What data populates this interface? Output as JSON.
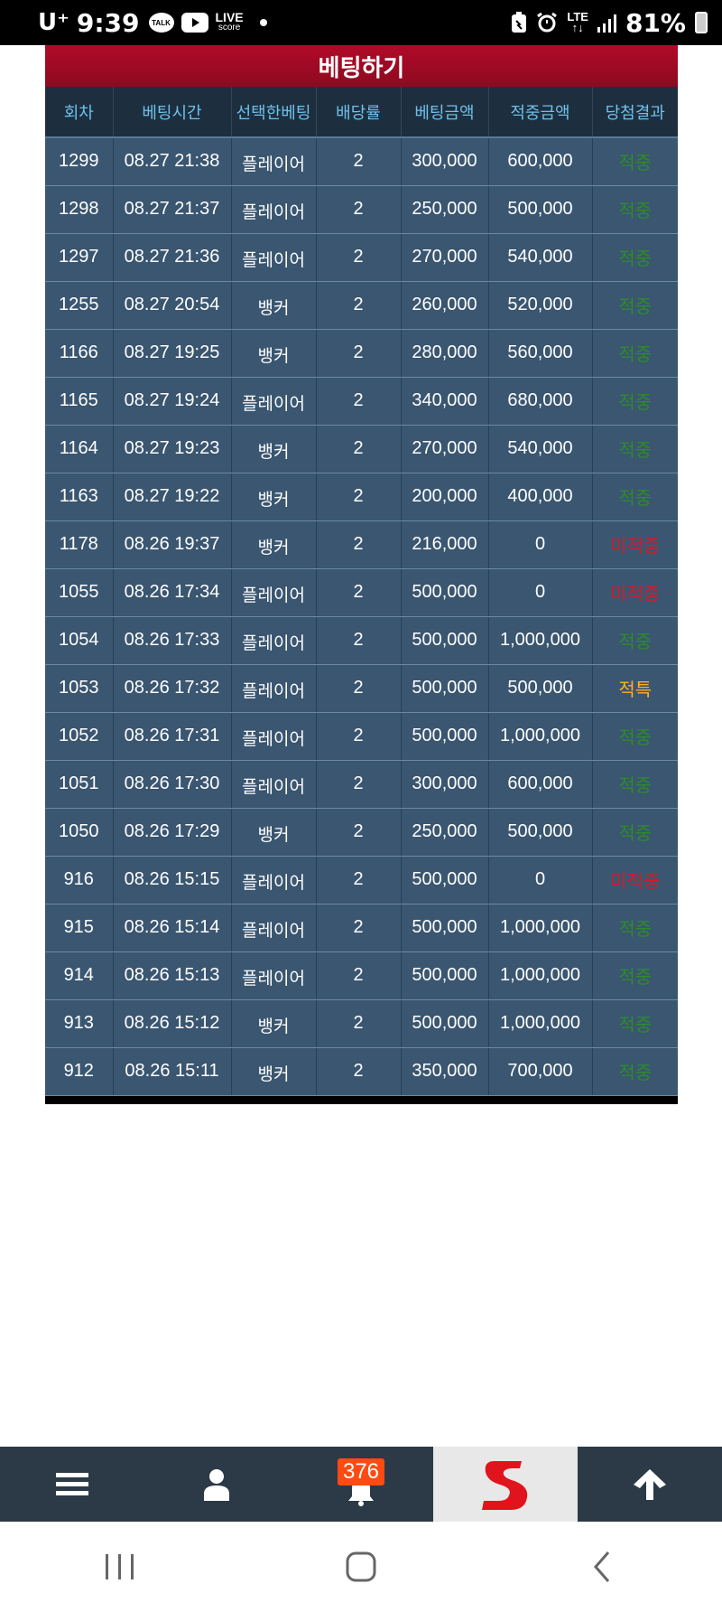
{
  "status_bar": {
    "carrier": "U⁺",
    "time": "9:39",
    "talk_label": "TALK",
    "live_label": "LIVE",
    "score_label": "score",
    "network": "LTE",
    "battery": "81%"
  },
  "panel": {
    "title": "베팅하기",
    "columns": [
      "회차",
      "베팅시간",
      "선택한베팅",
      "배당률",
      "베팅금액",
      "적중금액",
      "당첨결과"
    ],
    "rows": [
      {
        "round": "1299",
        "time": "08.27 21:38",
        "choice": "플레이어",
        "odds": "2",
        "bet": "300,000",
        "win": "600,000",
        "result": "적중",
        "result_type": "win"
      },
      {
        "round": "1298",
        "time": "08.27 21:37",
        "choice": "플레이어",
        "odds": "2",
        "bet": "250,000",
        "win": "500,000",
        "result": "적중",
        "result_type": "win"
      },
      {
        "round": "1297",
        "time": "08.27 21:36",
        "choice": "플레이어",
        "odds": "2",
        "bet": "270,000",
        "win": "540,000",
        "result": "적중",
        "result_type": "win"
      },
      {
        "round": "1255",
        "time": "08.27 20:54",
        "choice": "뱅커",
        "odds": "2",
        "bet": "260,000",
        "win": "520,000",
        "result": "적중",
        "result_type": "win"
      },
      {
        "round": "1166",
        "time": "08.27 19:25",
        "choice": "뱅커",
        "odds": "2",
        "bet": "280,000",
        "win": "560,000",
        "result": "적중",
        "result_type": "win"
      },
      {
        "round": "1165",
        "time": "08.27 19:24",
        "choice": "플레이어",
        "odds": "2",
        "bet": "340,000",
        "win": "680,000",
        "result": "적중",
        "result_type": "win"
      },
      {
        "round": "1164",
        "time": "08.27 19:23",
        "choice": "뱅커",
        "odds": "2",
        "bet": "270,000",
        "win": "540,000",
        "result": "적중",
        "result_type": "win"
      },
      {
        "round": "1163",
        "time": "08.27 19:22",
        "choice": "뱅커",
        "odds": "2",
        "bet": "200,000",
        "win": "400,000",
        "result": "적중",
        "result_type": "win"
      },
      {
        "round": "1178",
        "time": "08.26 19:37",
        "choice": "뱅커",
        "odds": "2",
        "bet": "216,000",
        "win": "0",
        "result": "미적중",
        "result_type": "miss"
      },
      {
        "round": "1055",
        "time": "08.26 17:34",
        "choice": "플레이어",
        "odds": "2",
        "bet": "500,000",
        "win": "0",
        "result": "미적중",
        "result_type": "miss"
      },
      {
        "round": "1054",
        "time": "08.26 17:33",
        "choice": "플레이어",
        "odds": "2",
        "bet": "500,000",
        "win": "1,000,000",
        "result": "적중",
        "result_type": "win"
      },
      {
        "round": "1053",
        "time": "08.26 17:32",
        "choice": "플레이어",
        "odds": "2",
        "bet": "500,000",
        "win": "500,000",
        "result": "적특",
        "result_type": "spec"
      },
      {
        "round": "1052",
        "time": "08.26 17:31",
        "choice": "플레이어",
        "odds": "2",
        "bet": "500,000",
        "win": "1,000,000",
        "result": "적중",
        "result_type": "win"
      },
      {
        "round": "1051",
        "time": "08.26 17:30",
        "choice": "플레이어",
        "odds": "2",
        "bet": "300,000",
        "win": "600,000",
        "result": "적중",
        "result_type": "win"
      },
      {
        "round": "1050",
        "time": "08.26 17:29",
        "choice": "뱅커",
        "odds": "2",
        "bet": "250,000",
        "win": "500,000",
        "result": "적중",
        "result_type": "win"
      },
      {
        "round": "916",
        "time": "08.26 15:15",
        "choice": "플레이어",
        "odds": "2",
        "bet": "500,000",
        "win": "0",
        "result": "미적중",
        "result_type": "miss"
      },
      {
        "round": "915",
        "time": "08.26 15:14",
        "choice": "플레이어",
        "odds": "2",
        "bet": "500,000",
        "win": "1,000,000",
        "result": "적중",
        "result_type": "win"
      },
      {
        "round": "914",
        "time": "08.26 15:13",
        "choice": "플레이어",
        "odds": "2",
        "bet": "500,000",
        "win": "1,000,000",
        "result": "적중",
        "result_type": "win"
      },
      {
        "round": "913",
        "time": "08.26 15:12",
        "choice": "뱅커",
        "odds": "2",
        "bet": "500,000",
        "win": "1,000,000",
        "result": "적중",
        "result_type": "win"
      },
      {
        "round": "912",
        "time": "08.26 15:11",
        "choice": "뱅커",
        "odds": "2",
        "bet": "350,000",
        "win": "700,000",
        "result": "적중",
        "result_type": "win"
      }
    ]
  },
  "bottom_nav": {
    "items": [
      {
        "icon": "menu-icon"
      },
      {
        "icon": "user-icon"
      },
      {
        "icon": "bell-icon",
        "badge": "376"
      },
      {
        "icon": "brand-logo"
      },
      {
        "icon": "arrow-up-icon"
      }
    ]
  },
  "colors": {
    "header_red": "#9e0a22",
    "table_head": "#1d2f3f",
    "row_bg": "#3a5670",
    "win": "#2e8b2a",
    "miss": "#d51a2a",
    "special": "#ffb01e",
    "nav_bg": "#2c3a47",
    "badge": "#ff4a12"
  }
}
